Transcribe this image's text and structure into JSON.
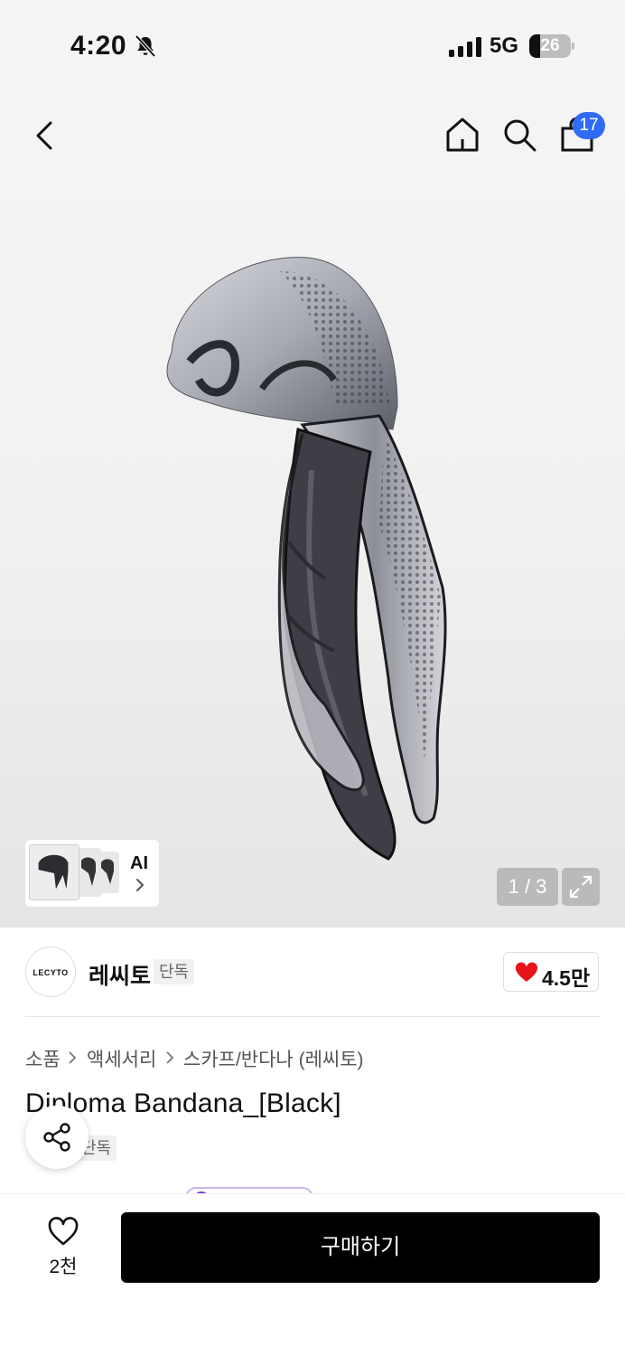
{
  "status_bar": {
    "time": "4:20",
    "network": "5G",
    "battery": "26",
    "battery_level": 0.26,
    "icons": [
      "bell-slash-icon",
      "signal-icon"
    ]
  },
  "nav": {
    "cart_count": "17",
    "icons": [
      "back-icon",
      "home-icon",
      "search-icon",
      "bag-icon"
    ]
  },
  "gallery": {
    "ai_label": "AI",
    "counter": "1 / 3",
    "current_image": 1,
    "total_images": 3
  },
  "brand": {
    "logo_text": "LECYTO",
    "name": "레씨토",
    "tag": "단독",
    "likes": "4.5만"
  },
  "breadcrumb": [
    "소품",
    "액세서리",
    "스카프/반다나 (레씨토)"
  ],
  "product": {
    "title": "Diploma Bandana_[Black]",
    "tag": "단독"
  },
  "bottom_bar": {
    "wish_count": "2천",
    "buy_label": "구매하기"
  },
  "colors": {
    "badge": "#2f6bf4",
    "heart": "#e8141b",
    "buy_button": "#000000",
    "ai_pill": "#7a3fd8"
  }
}
